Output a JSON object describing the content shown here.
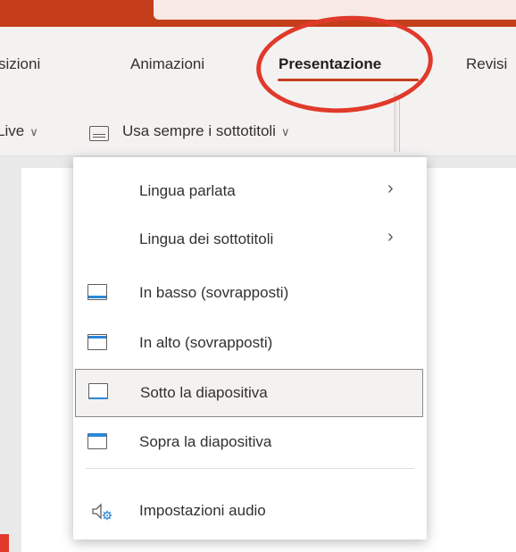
{
  "ribbon": {
    "tabs": [
      {
        "label": "sizioni",
        "active": false
      },
      {
        "label": "Animazioni",
        "active": false
      },
      {
        "label": "Presentazione",
        "active": true
      },
      {
        "label": "Revisi",
        "active": false
      }
    ]
  },
  "commands": {
    "live_label": "Live",
    "subtitles_label": "Usa sempre i sottotitoli"
  },
  "menu": {
    "items": [
      {
        "label": "Lingua parlata",
        "submenu": true
      },
      {
        "label": "Lingua dei sottotitoli",
        "submenu": true
      },
      {
        "label": "In basso (sovrapposti)",
        "icon": "subtitle-bottom-overlay-icon"
      },
      {
        "label": "In alto (sovrapposti)",
        "icon": "subtitle-top-overlay-icon"
      },
      {
        "label": "Sotto la diapositiva",
        "icon": "subtitle-below-slide-icon",
        "selected": true
      },
      {
        "label": "Sopra la diapositiva",
        "icon": "subtitle-above-slide-icon"
      },
      {
        "label": "Impostazioni audio",
        "icon": "audio-settings-icon"
      }
    ]
  },
  "colors": {
    "accent": "#c43e1c",
    "highlight_ellipse": "#e03a2b",
    "icon_blue": "#2b88d8"
  }
}
